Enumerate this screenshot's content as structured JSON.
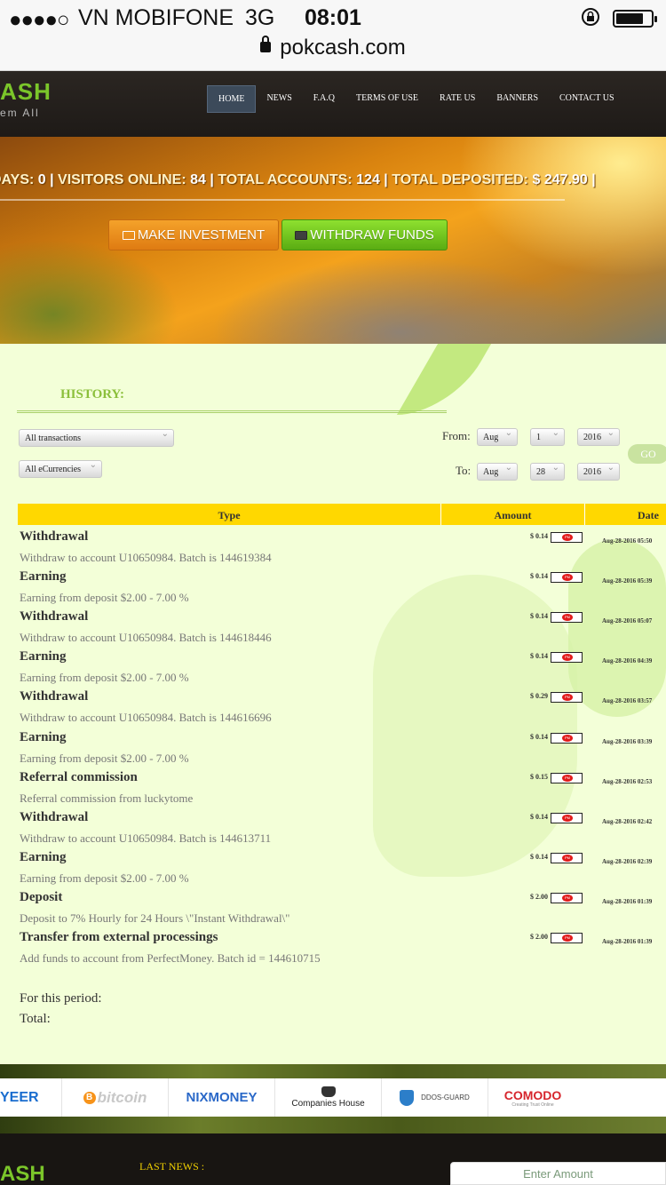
{
  "statusbar": {
    "signal": "●●●●○",
    "carrier": "VN MOBIFONE",
    "network": "3G",
    "time": "08:01",
    "battery_level": 0.8,
    "url": "pokcash.com"
  },
  "header": {
    "logo": "ASH",
    "logo_sub": "em All",
    "nav": [
      "HOME",
      "NEWS",
      "F.A.Q",
      "TERMS OF USE",
      "RATE US",
      "BANNERS",
      "CONTACT US"
    ],
    "active_nav": "HOME"
  },
  "hero": {
    "stats": [
      {
        "label": "DAYS:",
        "value": "0"
      },
      {
        "label": "VISITORS ONLINE:",
        "value": "84"
      },
      {
        "label": "TOTAL ACCOUNTS:",
        "value": "124"
      },
      {
        "label": "TOTAL DEPOSITED:",
        "value": "$ 247.90"
      }
    ],
    "invest_button": "MAKE INVESTMENT",
    "withdraw_button": "WITHDRAW FUNDS"
  },
  "history": {
    "title": "HISTORY:",
    "type_filter": "All transactions",
    "currency_filter": "All eCurrencies",
    "from_label": "From:",
    "to_label": "To:",
    "from": {
      "month": "Aug",
      "day": "1",
      "year": "2016"
    },
    "to": {
      "month": "Aug",
      "day": "28",
      "year": "2016"
    },
    "go_button": "GO",
    "columns": [
      "Type",
      "Amount",
      "Date"
    ],
    "rows": [
      {
        "type": "Withdrawal",
        "desc": "Withdraw to account U10650984. Batch is 144619384",
        "amount": "$ 0.14",
        "date": "Aug-28-2016 05:50"
      },
      {
        "type": "Earning",
        "desc": "Earning from deposit $2.00 - 7.00 %",
        "amount": "$ 0.14",
        "date": "Aug-28-2016 05:39"
      },
      {
        "type": "Withdrawal",
        "desc": "Withdraw to account U10650984. Batch is 144618446",
        "amount": "$ 0.14",
        "date": "Aug-28-2016 05:07"
      },
      {
        "type": "Earning",
        "desc": "Earning from deposit $2.00 - 7.00 %",
        "amount": "$ 0.14",
        "date": "Aug-28-2016 04:39"
      },
      {
        "type": "Withdrawal",
        "desc": "Withdraw to account U10650984. Batch is 144616696",
        "amount": "$ 0.29",
        "date": "Aug-28-2016 03:57"
      },
      {
        "type": "Earning",
        "desc": "Earning from deposit $2.00 - 7.00 %",
        "amount": "$ 0.14",
        "date": "Aug-28-2016 03:39"
      },
      {
        "type": "Referral commission",
        "desc": "Referral commission from luckytome",
        "amount": "$ 0.15",
        "date": "Aug-28-2016 02:53"
      },
      {
        "type": "Withdrawal",
        "desc": "Withdraw to account U10650984. Batch is 144613711",
        "amount": "$ 0.14",
        "date": "Aug-28-2016 02:42"
      },
      {
        "type": "Earning",
        "desc": "Earning from deposit $2.00 - 7.00 %",
        "amount": "$ 0.14",
        "date": "Aug-28-2016 02:39"
      },
      {
        "type": "Deposit",
        "desc": "Deposit to 7% Hourly for 24 Hours \\\"Instant Withdrawal\\\"",
        "amount": "$ 2.00",
        "date": "Aug-28-2016 01:39"
      },
      {
        "type": "Transfer from external processings",
        "desc": "Add funds to account from PerfectMoney. Batch id = 144610715",
        "amount": "$ 2.00",
        "date": "Aug-28-2016 01:39"
      }
    ],
    "pm_badge": "PM",
    "period_label": "For this period:",
    "total_label": "Total:"
  },
  "partners": {
    "payeer": "YEER",
    "bitcoin": "bitcoin",
    "bitcoin_symbol": "B",
    "nixmoney": "NIXMONEY",
    "companies_house": "Companies House",
    "ddos_guard": "DDOS-GUARD",
    "comodo": "COMODO",
    "comodo_tagline": "Creating Trust Online"
  },
  "footer": {
    "logo": "ASH",
    "last_news": "LAST NEWS :",
    "amount_placeholder": "Enter Amount"
  }
}
